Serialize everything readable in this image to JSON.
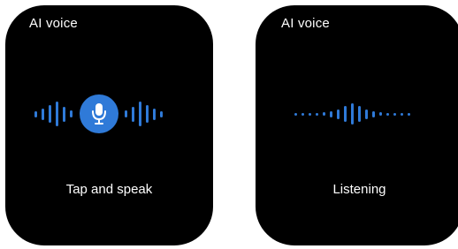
{
  "screens": [
    {
      "title": "AI voice",
      "caption": "Tap and speak",
      "state": "idle",
      "icon": "microphone-icon",
      "wave_levels_left": [
        0.22,
        0.38,
        0.58,
        0.82,
        0.5,
        0.24
      ],
      "wave_levels_right": [
        0.24,
        0.5,
        0.82,
        0.58,
        0.38,
        0.22
      ]
    },
    {
      "title": "AI voice",
      "caption": "Listening",
      "state": "listening",
      "wave_levels": [
        0.06,
        0.06,
        0.06,
        0.08,
        0.12,
        0.2,
        0.32,
        0.52,
        0.7,
        0.52,
        0.32,
        0.2,
        0.12,
        0.08,
        0.06,
        0.06,
        0.06
      ]
    }
  ],
  "colors": {
    "accent": "#2f7ad8",
    "screen_background": "#000000",
    "text": "#ffffff"
  }
}
